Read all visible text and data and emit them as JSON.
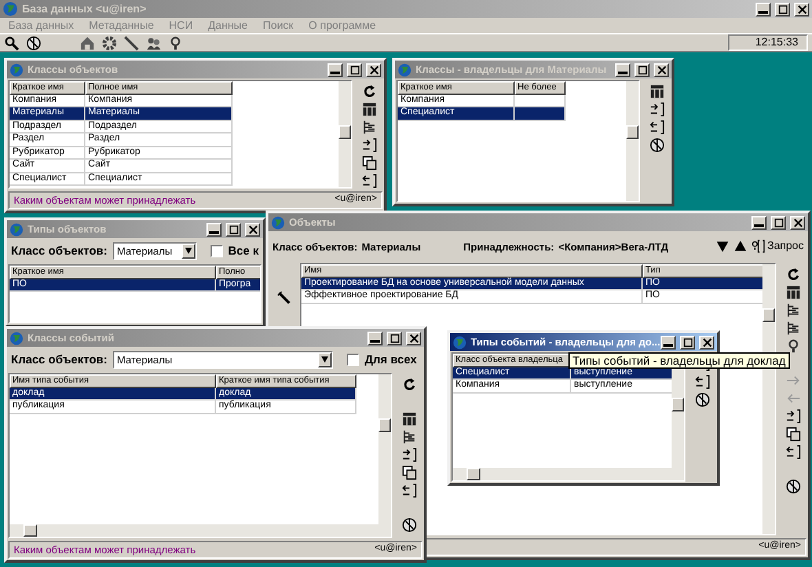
{
  "app": {
    "title": "База данных <u@iren>",
    "menu": [
      {
        "label": "База данных"
      },
      {
        "label": "Метаданные"
      },
      {
        "label": "НСИ"
      },
      {
        "label": "Данные"
      },
      {
        "label": "Поиск"
      },
      {
        "label": "О программе"
      }
    ],
    "clock": "12:15:33"
  },
  "windows": [
    {
      "title": "Классы объектов",
      "active": false,
      "grid": {
        "columns": [
          "Краткое имя",
          "Полное имя"
        ],
        "rows": [
          {
            "cells": [
              "Компания",
              "Компания"
            ],
            "selected": false
          },
          {
            "cells": [
              "Материалы",
              "Материалы"
            ],
            "selected": true
          },
          {
            "cells": [
              "Подраздел",
              "Подраздел"
            ],
            "selected": false
          },
          {
            "cells": [
              "Раздел",
              "Раздел"
            ],
            "selected": false
          },
          {
            "cells": [
              "Рубрикатор",
              "Рубрикатор"
            ],
            "selected": false
          },
          {
            "cells": [
              "Сайт",
              "Сайт"
            ],
            "selected": false
          },
          {
            "cells": [
              "Специалист",
              "Специалист"
            ],
            "selected": false
          }
        ]
      },
      "status": {
        "text": "Каким объектам может принадлежать",
        "user": "<u@iren>"
      }
    },
    {
      "title": "Классы - владельцы для Материалы",
      "active": false,
      "grid": {
        "columns": [
          "Краткое имя",
          "Не более"
        ],
        "rows": [
          {
            "cells": [
              "Компания"
            ],
            "selected": false
          },
          {
            "cells": [
              "Специалист"
            ],
            "selected": true
          }
        ]
      }
    },
    {
      "title": "Типы объектов",
      "active": false,
      "filter": {
        "label": "Класс объектов:",
        "value": "Материалы",
        "checkbox": "Все к",
        "checked": false
      },
      "grid": {
        "columns": [
          "Краткое имя",
          "Полно"
        ],
        "rows": [
          {
            "cells": [
              "ПО",
              "Програ"
            ],
            "selected": true
          }
        ]
      }
    },
    {
      "title": "Объекты",
      "active": false,
      "info": [
        {
          "label": "Класс объектов:",
          "value": "Материалы"
        },
        {
          "label": "Принадлежность:",
          "value": "<Компания>Вега-ЛТД"
        }
      ],
      "query": "Запрос",
      "grid": {
        "columns": [
          "Имя",
          "Тип"
        ],
        "rows": [
          {
            "cells": [
              "Проектирование БД на основе универсальной модели данных",
              "ПО"
            ],
            "selected": true
          },
          {
            "cells": [
              "Эффективное проектирование БД",
              "ПО"
            ],
            "selected": false
          }
        ]
      },
      "status": {
        "user": "<u@iren>"
      }
    },
    {
      "title": "Классы событий",
      "active": false,
      "filter": {
        "label": "Класс объектов:",
        "value": "Материалы",
        "checkbox": "Для всех",
        "checked": false
      },
      "grid": {
        "columns": [
          "Имя типа события",
          "Краткое имя типа события"
        ],
        "rows": [
          {
            "cells": [
              "доклад",
              "доклад"
            ],
            "selected": true
          },
          {
            "cells": [
              "публикация",
              "публикация"
            ],
            "selected": false
          }
        ]
      },
      "status": {
        "text": "Каким объектам может принадлежать",
        "user": "<u@iren>"
      }
    },
    {
      "title": "Типы событий - владельцы для до...",
      "active": true,
      "grid": {
        "columns": [
          "Класс объекта владельца"
        ],
        "rows": [
          {
            "cells": [
              "Специалист",
              "выступление"
            ],
            "selected": true
          },
          {
            "cells": [
              "Компания",
              "выступление"
            ],
            "selected": false
          }
        ]
      }
    }
  ],
  "tooltip": "Типы событий - владельцы для доклад"
}
